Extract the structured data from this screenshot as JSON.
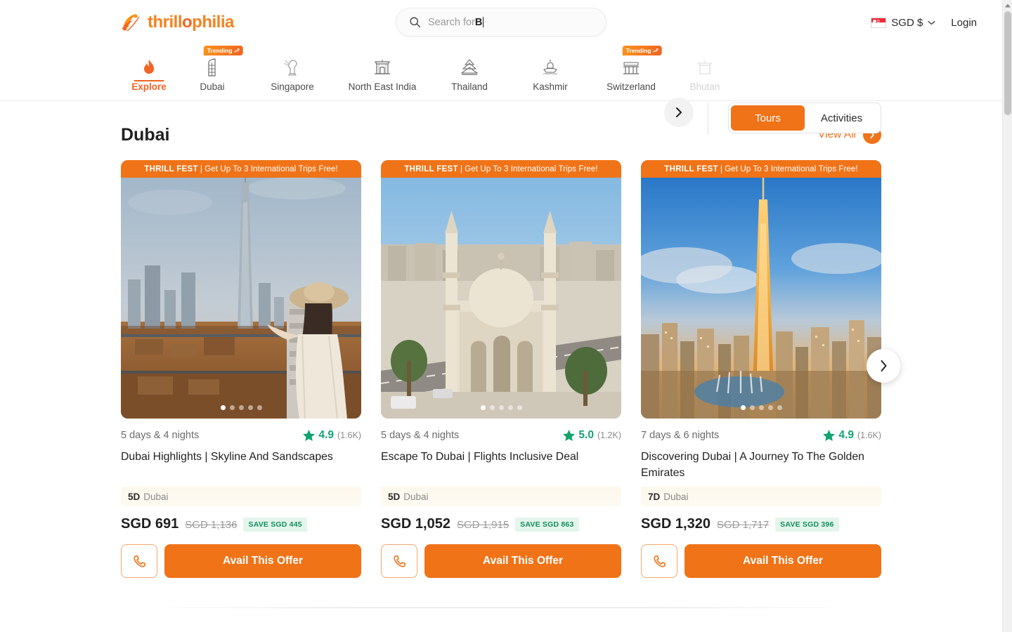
{
  "header": {
    "logo_text_parts": [
      "thrill",
      "o",
      "philia"
    ],
    "logo_name": "thrillophilia",
    "search": {
      "placeholder_prefix": "Search for ",
      "typed": "B"
    },
    "currency": {
      "label": "SGD $",
      "flag": "singapore-flag"
    },
    "login_label": "Login"
  },
  "nav": {
    "items": [
      {
        "label": "Explore",
        "icon": "flame-icon",
        "active": true,
        "badge": null,
        "faded": false
      },
      {
        "label": "Dubai",
        "icon": "burj-al-arab-icon",
        "active": false,
        "badge": "Trending",
        "faded": false
      },
      {
        "label": "Singapore",
        "icon": "merlion-icon",
        "active": false,
        "badge": null,
        "faded": false
      },
      {
        "label": "North East India",
        "icon": "gateway-icon",
        "active": false,
        "badge": null,
        "faded": false
      },
      {
        "label": "Thailand",
        "icon": "thai-temple-icon",
        "active": false,
        "badge": null,
        "faded": false
      },
      {
        "label": "Kashmir",
        "icon": "shikara-boat-icon",
        "active": false,
        "badge": null,
        "faded": false
      },
      {
        "label": "Switzerland",
        "icon": "chapel-bridge-icon",
        "active": false,
        "badge": "Trending",
        "faded": false
      },
      {
        "label": "Bhutan",
        "icon": "dzong-icon",
        "active": false,
        "badge": null,
        "faded": true
      }
    ],
    "next_icon": "chevron-right-icon",
    "toggle": {
      "options": [
        "Tours",
        "Activities"
      ],
      "selected": "Tours"
    }
  },
  "section": {
    "title": "Dubai",
    "view_all_label": "View All",
    "view_all_icon": "chevron-right-icon",
    "carousel_next_icon": "chevron-right-icon"
  },
  "cards": [
    {
      "ribbon_bold": "THRILL FEST",
      "ribbon_rest": "| Get Up To 3 International Trips Free!",
      "dots": 5,
      "active_dot": 0,
      "duration": "5 days & 4 nights",
      "rating": "4.9",
      "rating_count": "(1.6K)",
      "title": "Dubai Highlights | Skyline And Sandscapes",
      "tag_days": "5D",
      "tag_place": "Dubai",
      "price_now": "SGD 691",
      "price_old": "SGD 1,136",
      "save": "SAVE SGD 445",
      "phone_icon": "phone-icon",
      "cta_label": "Avail This Offer",
      "scene": "burj-khalifa-woman-hat"
    },
    {
      "ribbon_bold": "THRILL FEST",
      "ribbon_rest": "| Get Up To 3 International Trips Free!",
      "dots": 5,
      "active_dot": 0,
      "duration": "5 days & 4 nights",
      "rating": "5.0",
      "rating_count": "(1.2K)",
      "title": "Escape To Dubai | Flights Inclusive Deal",
      "tag_days": "5D",
      "tag_place": "Dubai",
      "price_now": "SGD 1,052",
      "price_old": "SGD 1,915",
      "save": "SAVE SGD 863",
      "phone_icon": "phone-icon",
      "cta_label": "Avail This Offer",
      "scene": "jumeirah-mosque"
    },
    {
      "ribbon_bold": "THRILL FEST",
      "ribbon_rest": "| Get Up To 3 International Trips Free!",
      "dots": 5,
      "active_dot": 0,
      "duration": "7 days & 6 nights",
      "rating": "4.9",
      "rating_count": "(1.6K)",
      "title": "Discovering Dubai | A Journey To The Golden Emirates",
      "tag_days": "7D",
      "tag_place": "Dubai",
      "price_now": "SGD 1,320",
      "price_old": "SGD 1,717",
      "save": "SAVE SGD 396",
      "phone_icon": "phone-icon",
      "cta_label": "Avail This Offer",
      "scene": "dubai-skyline-sunset"
    }
  ],
  "colors": {
    "brand_orange": "#f07318",
    "brand_orange_light": "#f7941d",
    "rating_green": "#10a36e",
    "save_green": "#0f8f5f",
    "save_bg": "#e4f5ec",
    "text_dark": "#1f1f1f",
    "text_muted": "#6b6b6b"
  }
}
